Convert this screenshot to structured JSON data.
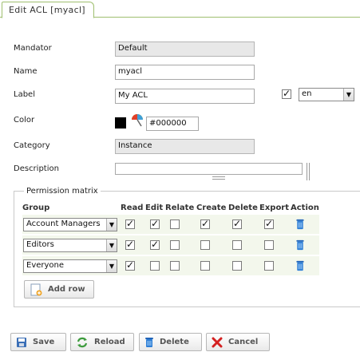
{
  "tab": {
    "title": "Edit ACL [myacl]"
  },
  "form": {
    "mandator": {
      "label": "Mandator",
      "value": "Default"
    },
    "name": {
      "label": "Name",
      "value": "myacl"
    },
    "label": {
      "label": "Label",
      "value": "My ACL",
      "language": "en"
    },
    "color": {
      "label": "Color",
      "value": "#000000"
    },
    "category": {
      "label": "Category",
      "value": "Instance"
    },
    "description": {
      "label": "Description",
      "value": ""
    }
  },
  "permission_matrix": {
    "legend": "Permission matrix",
    "columns": [
      "Group",
      "Read",
      "Edit",
      "Relate",
      "Create",
      "Delete",
      "Export",
      "Action"
    ],
    "rows": [
      {
        "group": "Account Managers",
        "read": true,
        "edit": true,
        "relate": false,
        "create": true,
        "delete": true,
        "export": true
      },
      {
        "group": "Editors",
        "read": true,
        "edit": true,
        "relate": false,
        "create": false,
        "delete": false,
        "export": false
      },
      {
        "group": "Everyone",
        "read": true,
        "edit": false,
        "relate": false,
        "create": false,
        "delete": false,
        "export": false
      }
    ],
    "add_row_label": "Add row"
  },
  "buttons": {
    "save": "Save",
    "reload": "Reload",
    "delete": "Delete",
    "cancel": "Cancel"
  },
  "colors": {
    "tab_border": "#9fbf6f",
    "row_bg": "#f3f7ec",
    "trash_blue": "#2f7fd6"
  }
}
